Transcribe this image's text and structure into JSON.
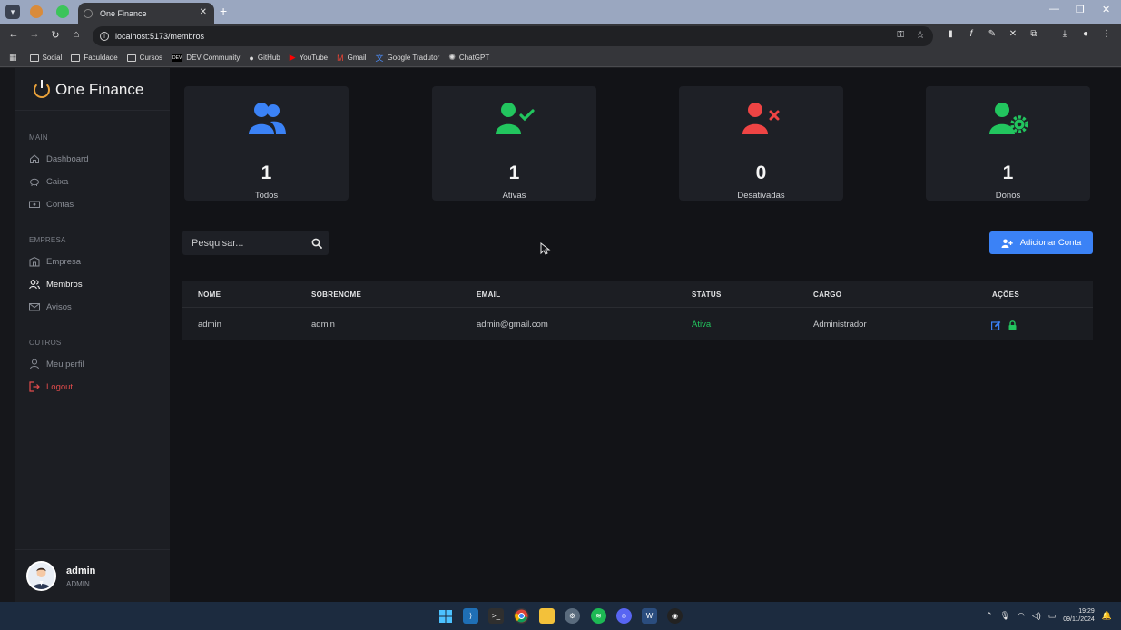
{
  "browser": {
    "tab_title": "One Finance",
    "url": "localhost:5173/membros",
    "bookmarks": [
      {
        "label": "Social",
        "icon": "folder-icon"
      },
      {
        "label": "Faculdade",
        "icon": "folder-icon"
      },
      {
        "label": "Cursos",
        "icon": "folder-icon"
      },
      {
        "label": "DEV Community",
        "icon": "dev-icon"
      },
      {
        "label": "GitHub",
        "icon": "github-icon"
      },
      {
        "label": "YouTube",
        "icon": "youtube-icon"
      },
      {
        "label": "Gmail",
        "icon": "gmail-icon"
      },
      {
        "label": "Google Tradutor",
        "icon": "translate-icon"
      },
      {
        "label": "ChatGPT",
        "icon": "chatgpt-icon"
      }
    ]
  },
  "sidebar": {
    "brand": "One Finance",
    "sections": {
      "main": "MAIN",
      "empresa": "EMPRESA",
      "outros": "OUTROS"
    },
    "items": {
      "dashboard": "Dashboard",
      "caixa": "Caixa",
      "contas": "Contas",
      "empresa": "Empresa",
      "membros": "Membros",
      "avisos": "Avisos",
      "perfil": "Meu perfil",
      "logout": "Logout"
    },
    "user": {
      "name": "admin",
      "role": "ADMIN"
    }
  },
  "stats": [
    {
      "value": "1",
      "label": "Todos",
      "icon": "users-icon",
      "color": "#3b82f6"
    },
    {
      "value": "1",
      "label": "Ativas",
      "icon": "user-check-icon",
      "color": "#22c55e"
    },
    {
      "value": "0",
      "label": "Desativadas",
      "icon": "user-x-icon",
      "color": "#ef4444"
    },
    {
      "value": "1",
      "label": "Donos",
      "icon": "user-gear-icon",
      "color": "#22c55e"
    }
  ],
  "search": {
    "placeholder": "Pesquisar..."
  },
  "add_button": "Adicionar Conta",
  "table": {
    "headers": {
      "nome": "NOME",
      "sobrenome": "SOBRENOME",
      "email": "EMAIL",
      "status": "STATUS",
      "cargo": "CARGO",
      "acoes": "AÇÕES"
    },
    "rows": [
      {
        "nome": "admin",
        "sobrenome": "admin",
        "email": "admin@gmail.com",
        "status": "Ativa",
        "cargo": "Administrador"
      }
    ]
  },
  "taskbar": {
    "time": "19:29",
    "date": "09/11/2024"
  },
  "colors": {
    "accent": "#3b82f6",
    "success": "#22c55e",
    "danger": "#ef4444",
    "background": "#121317",
    "sidebar": "#1c1e23"
  }
}
